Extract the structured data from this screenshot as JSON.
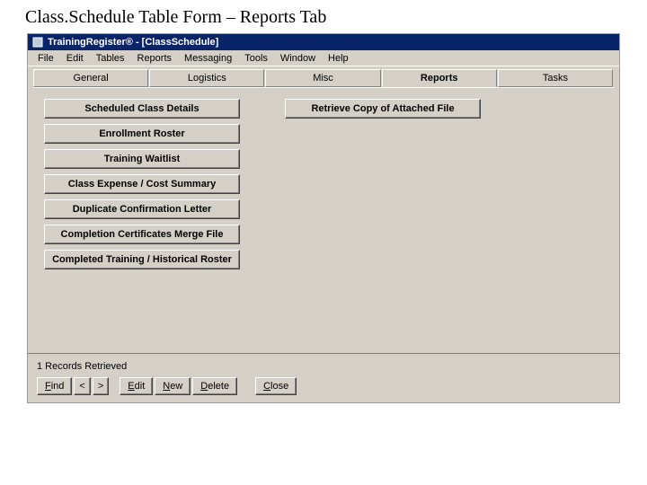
{
  "page_heading": "Class.Schedule Table Form – Reports Tab",
  "window": {
    "title": "TrainingRegister® - [ClassSchedule]"
  },
  "menu": {
    "items": [
      "File",
      "Edit",
      "Tables",
      "Reports",
      "Messaging",
      "Tools",
      "Window",
      "Help"
    ]
  },
  "tabs": {
    "items": [
      {
        "label": "General",
        "active": false
      },
      {
        "label": "Logistics",
        "active": false
      },
      {
        "label": "Misc",
        "active": false
      },
      {
        "label": "Reports",
        "active": true
      },
      {
        "label": "Tasks",
        "active": false
      }
    ]
  },
  "reports": {
    "left": [
      "Scheduled Class Details",
      "Enrollment Roster",
      "Training Waitlist",
      "Class Expense / Cost Summary",
      "Duplicate Confirmation Letter",
      "Completion Certificates Merge File",
      "Completed Training / Historical Roster"
    ],
    "right": [
      "Retrieve Copy of Attached File"
    ]
  },
  "footer": {
    "status": "1 Records Retrieved",
    "find": "Find",
    "prev": "<",
    "next": ">",
    "edit": "Edit",
    "new": "New",
    "delete": "Delete",
    "close": "Close"
  }
}
